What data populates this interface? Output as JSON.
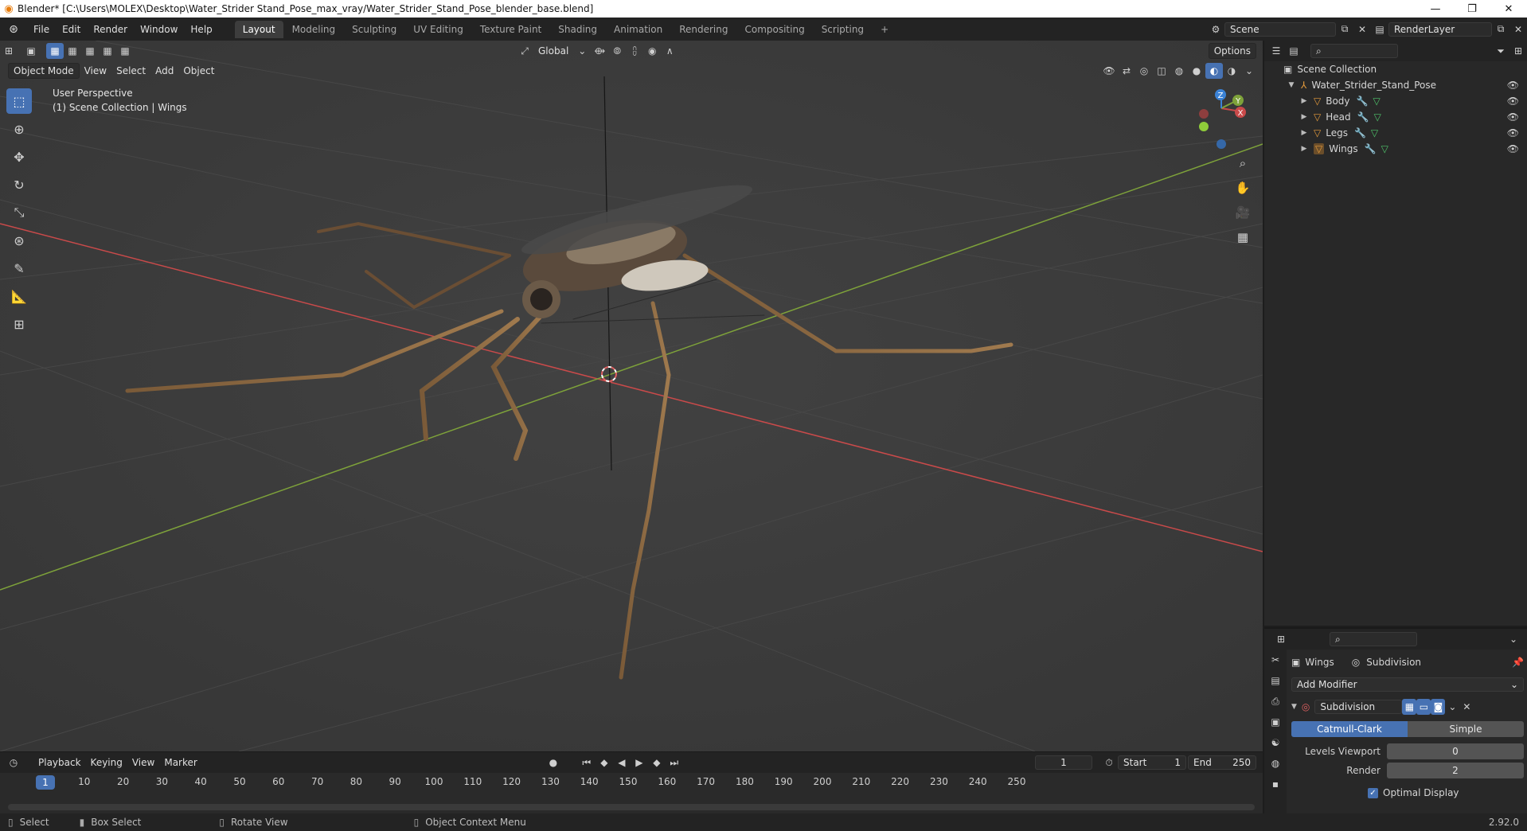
{
  "window": {
    "title": "Blender* [C:\\Users\\MOLEX\\Desktop\\Water_Strider Stand_Pose_max_vray/Water_Strider_Stand_Pose_blender_base.blend]",
    "controls": {
      "minimize": "—",
      "restore": "❐",
      "close": "✕"
    }
  },
  "menu": [
    "File",
    "Edit",
    "Render",
    "Window",
    "Help"
  ],
  "workspaces": {
    "tabs": [
      "Layout",
      "Modeling",
      "Sculpting",
      "UV Editing",
      "Texture Paint",
      "Shading",
      "Animation",
      "Rendering",
      "Compositing",
      "Scripting"
    ],
    "add": "+"
  },
  "scene": {
    "name": "Scene",
    "render_layer": "RenderLayer"
  },
  "viewport": {
    "mode": "Object Mode",
    "menus": [
      "View",
      "Select",
      "Add",
      "Object"
    ],
    "transform_orientation": "Global",
    "options": "Options",
    "perspective": "User Perspective",
    "collection_info": "(1) Scene Collection | Wings",
    "gizmo": {
      "x": "X",
      "y": "Y",
      "z": "Z"
    }
  },
  "timeline": {
    "menus": [
      "Playback",
      "Keying",
      "View",
      "Marker"
    ],
    "current_frame": "1",
    "start_label": "Start",
    "start": "1",
    "end_label": "End",
    "end": "250",
    "ticks": [
      "10",
      "20",
      "30",
      "40",
      "50",
      "60",
      "70",
      "80",
      "90",
      "100",
      "110",
      "120",
      "130",
      "140",
      "150",
      "160",
      "170",
      "180",
      "190",
      "200",
      "210",
      "220",
      "230",
      "240",
      "250"
    ],
    "frame_marker": "1"
  },
  "statusbar": {
    "items": [
      "Select",
      "Box Select",
      "Rotate View",
      "Object Context Menu"
    ],
    "version": "2.92.0"
  },
  "outliner": {
    "root": "Scene Collection",
    "collection": "Water_Strider_Stand_Pose",
    "objects": [
      "Body",
      "Head",
      "Legs",
      "Wings"
    ]
  },
  "properties": {
    "object": "Wings",
    "modifier_context": "Subdivision",
    "add_modifier": "Add Modifier",
    "modifier_name": "Subdivision",
    "algorithm": {
      "options": [
        "Catmull-Clark",
        "Simple"
      ],
      "selected": "Catmull-Clark"
    },
    "levels_viewport_label": "Levels Viewport",
    "levels_viewport": "0",
    "render_label": "Render",
    "render": "2",
    "optimal_display_label": "Optimal Display"
  },
  "colors": {
    "accent": "#4772b3",
    "x_axis": "#c94a4a",
    "y_axis": "#7ea23a",
    "viewport_bg": "#3c3c3c"
  }
}
